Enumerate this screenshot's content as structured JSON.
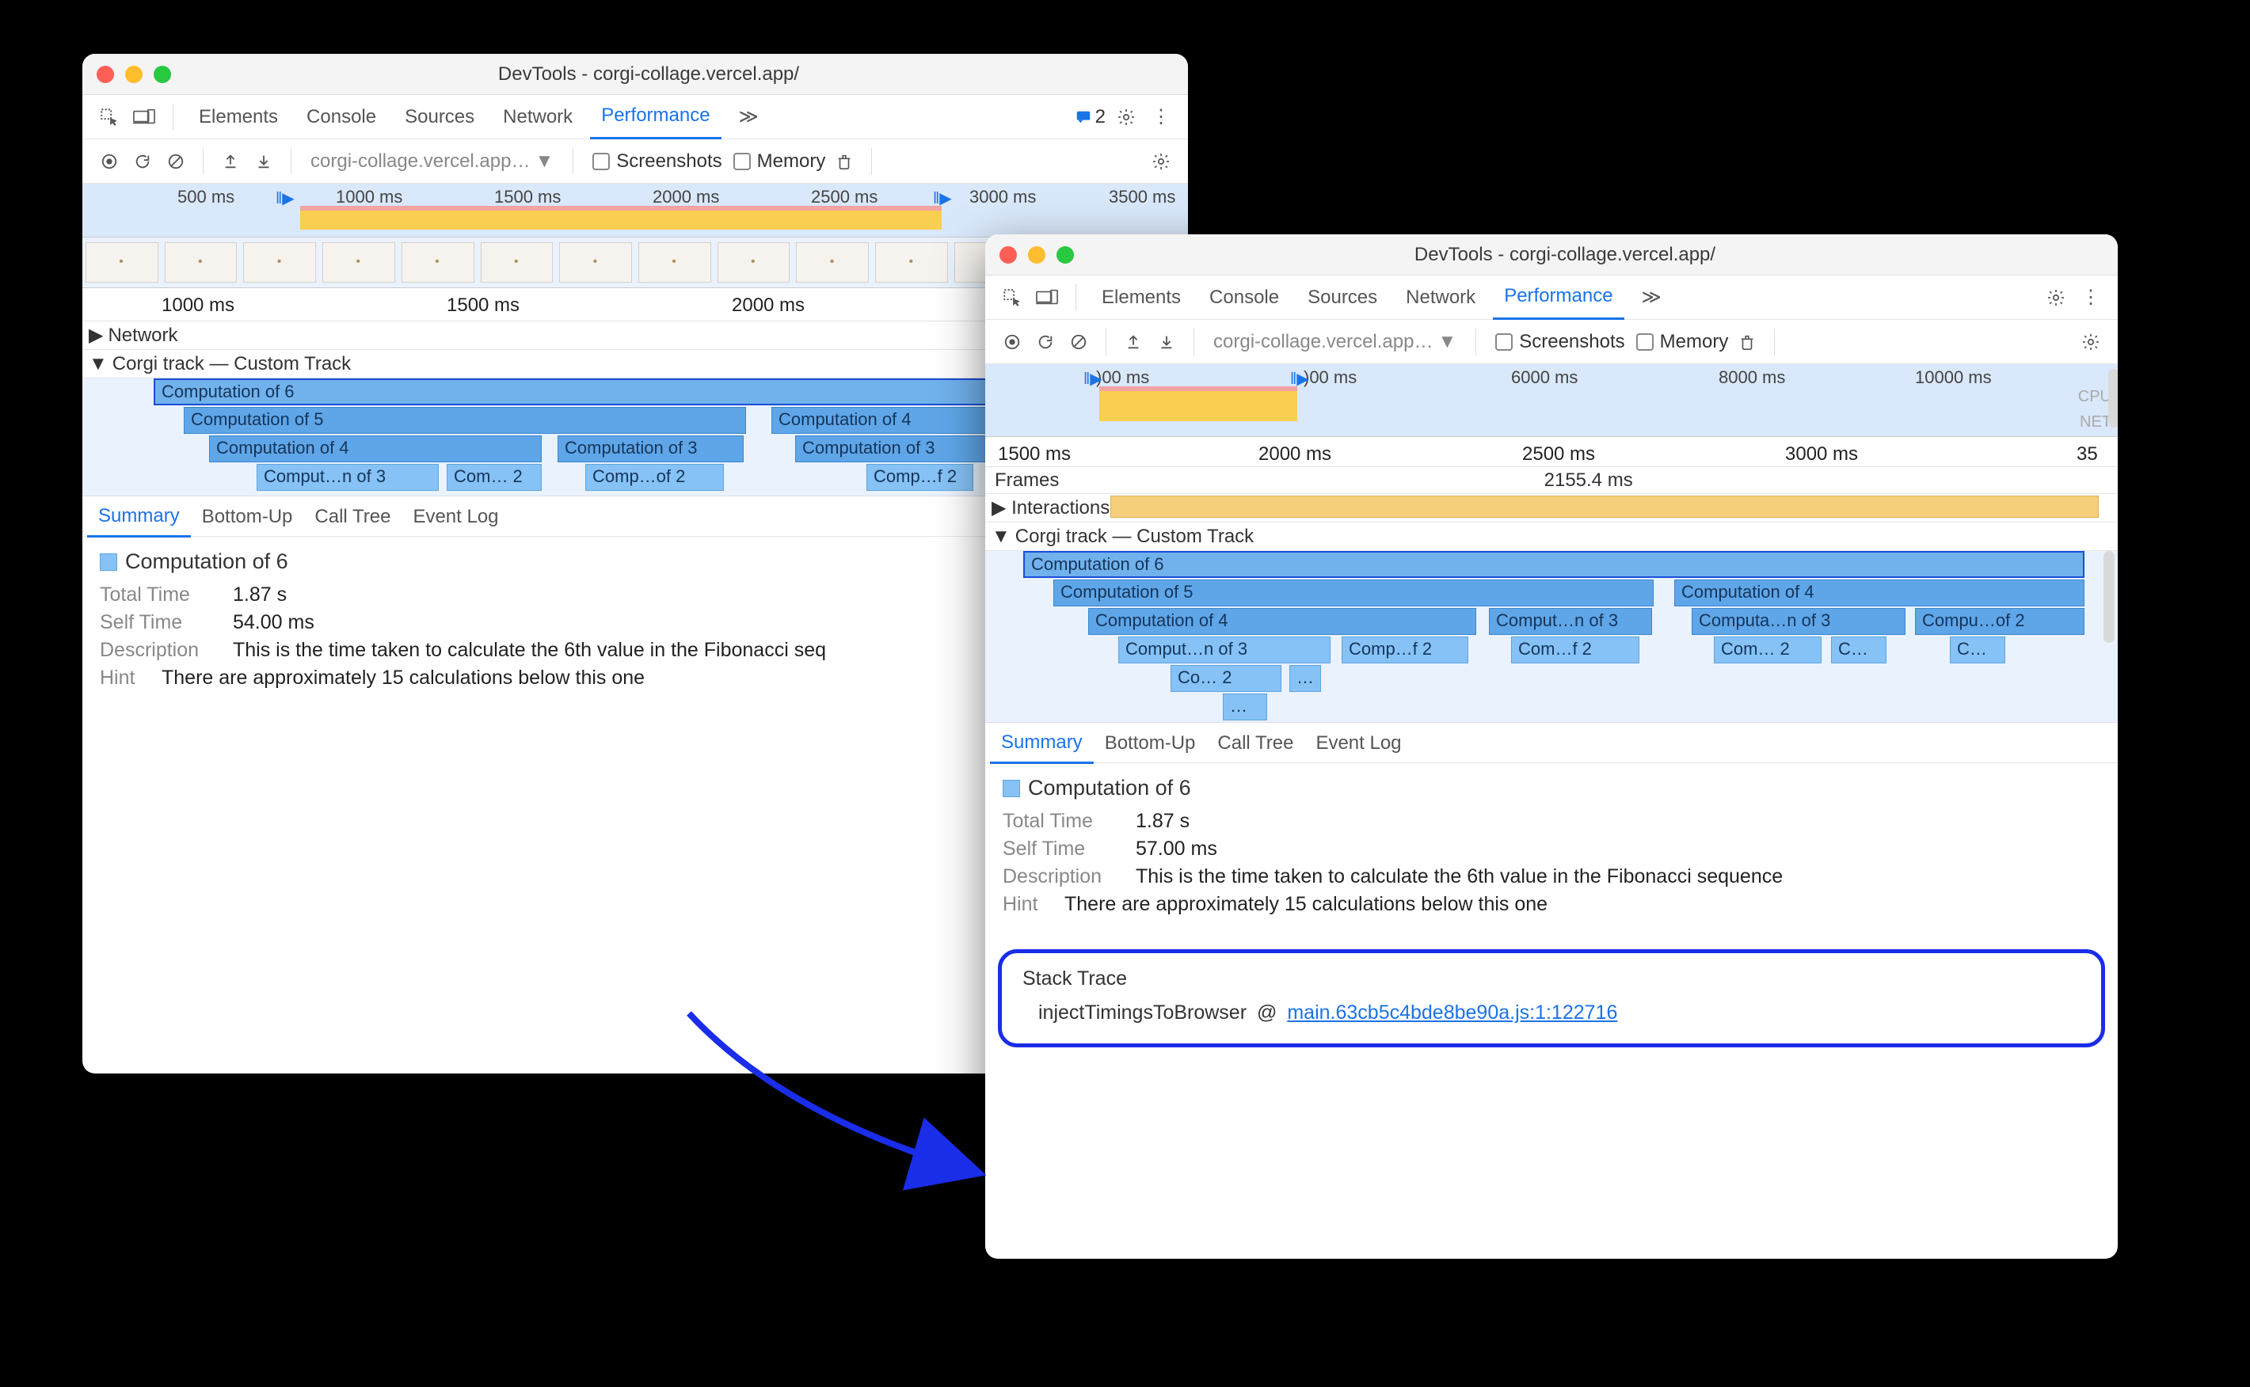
{
  "window1": {
    "title": "DevTools - corgi-collage.vercel.app/",
    "tabs": [
      "Elements",
      "Console",
      "Sources",
      "Network",
      "Performance"
    ],
    "active_tab": "Performance",
    "badge_count": "2",
    "url_dropdown": "corgi-collage.vercel.app…",
    "checkboxes": {
      "screenshots": "Screenshots",
      "memory": "Memory"
    },
    "minimap_ticks": [
      "500 ms",
      "1000 ms",
      "1500 ms",
      "2000 ms",
      "2500 ms",
      "3000 ms",
      "3500 ms"
    ],
    "ruler_ticks": [
      "1000 ms",
      "1500 ms",
      "2000 ms"
    ],
    "track_network": "Network",
    "track_custom": "Corgi track — Custom Track",
    "flame": {
      "l0": "Computation of 6",
      "l1a": "Computation of 5",
      "l1b": "Computation of 4",
      "l2a": "Computation of 4",
      "l2b": "Computation of 3",
      "l2c": "Computation of 3",
      "l3a": "Comput…n of 3",
      "l3b": "Com… 2",
      "l3c": "Comp…of 2",
      "l3d": "Comp…f 2"
    },
    "detail_tabs": [
      "Summary",
      "Bottom-Up",
      "Call Tree",
      "Event Log"
    ],
    "summary": {
      "title": "Computation of 6",
      "total_label": "Total Time",
      "total_value": "1.87 s",
      "self_label": "Self Time",
      "self_value": "54.00 ms",
      "desc_label": "Description",
      "desc_value": "This is the time taken to calculate the 6th value in the Fibonacci seq",
      "hint_label": "Hint",
      "hint_value": "There are approximately 15 calculations below this one"
    }
  },
  "window2": {
    "title": "DevTools - corgi-collage.vercel.app/",
    "tabs": [
      "Elements",
      "Console",
      "Sources",
      "Network",
      "Performance"
    ],
    "active_tab": "Performance",
    "url_dropdown": "corgi-collage.vercel.app…",
    "checkboxes": {
      "screenshots": "Screenshots",
      "memory": "Memory"
    },
    "minimap_ticks_vis": [
      ")00 ms",
      ")00 ms",
      "6000 ms",
      "8000 ms",
      "10000 ms"
    ],
    "cpu_label": "CPU",
    "net_label": "NET",
    "ruler_ticks": [
      "1500 ms",
      "2000 ms",
      "2500 ms",
      "3000 ms",
      "35"
    ],
    "frames_label": "Frames",
    "frames_value": "2155.4 ms",
    "track_interactions": "Interactions",
    "track_custom": "Corgi track — Custom Track",
    "flame": {
      "l0": "Computation of 6",
      "l1a": "Computation of 5",
      "l1b": "Computation of 4",
      "l2a": "Computation of 4",
      "l2b": "Comput…n of 3",
      "l2c": "Computa…n of 3",
      "l2d": "Compu…of 2",
      "l3a": "Comput…n of 3",
      "l3b": "Comp…f 2",
      "l3c": "Com…f 2",
      "l3d": "Com… 2",
      "l3e": "C…",
      "l3f": "C…",
      "l4a": "Co… 2",
      "l4b": "…",
      "l4c": "…"
    },
    "detail_tabs": [
      "Summary",
      "Bottom-Up",
      "Call Tree",
      "Event Log"
    ],
    "summary": {
      "title": "Computation of 6",
      "total_label": "Total Time",
      "total_value": "1.87 s",
      "self_label": "Self Time",
      "self_value": "57.00 ms",
      "desc_label": "Description",
      "desc_value": "This is the time taken to calculate the 6th value in the Fibonacci sequence",
      "hint_label": "Hint",
      "hint_value": "There are approximately 15 calculations below this one"
    },
    "stack": {
      "header": "Stack Trace",
      "fn": "injectTimingsToBrowser",
      "at": "@",
      "link": "main.63cb5c4bde8be90a.js:1:122716"
    }
  }
}
